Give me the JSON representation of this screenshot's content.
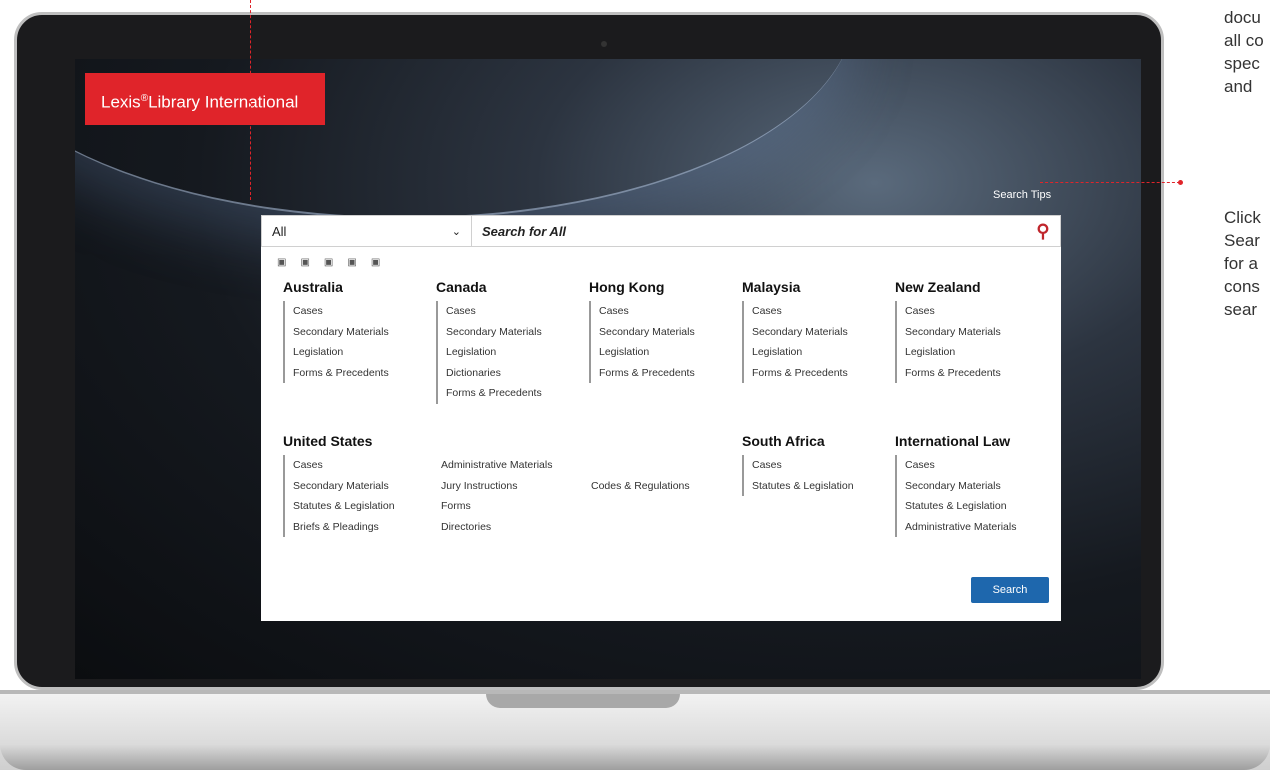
{
  "app": {
    "brand_prefix": "Lexis",
    "brand_reg": "®",
    "brand_suffix": "Library International"
  },
  "search": {
    "scope_label": "All",
    "placeholder": "Search for All",
    "tips_label": "Search Tips"
  },
  "jurisdictions_top": [
    {
      "name": "Australia",
      "items": [
        "Cases",
        "Secondary Materials",
        "Legislation",
        "Forms & Precedents"
      ]
    },
    {
      "name": "Canada",
      "items": [
        "Cases",
        "Secondary Materials",
        "Legislation",
        "Dictionaries",
        "Forms & Precedents"
      ]
    },
    {
      "name": "Hong Kong",
      "items": [
        "Cases",
        "Secondary Materials",
        "Legislation",
        "Forms & Precedents"
      ]
    },
    {
      "name": "Malaysia",
      "items": [
        "Cases",
        "Secondary Materials",
        "Legislation",
        "Forms & Precedents"
      ]
    },
    {
      "name": "New Zealand",
      "items": [
        "Cases",
        "Secondary Materials",
        "Legislation",
        "Forms & Precedents"
      ]
    }
  ],
  "united_states": {
    "name": "United States",
    "col1": [
      "Cases",
      "Secondary Materials",
      "Statutes & Legislation",
      "Briefs & Pleadings"
    ],
    "col2": [
      "Administrative Materials",
      "Jury Instructions",
      "Forms",
      "Directories"
    ],
    "col3": [
      "Codes & Regulations"
    ]
  },
  "south_africa": {
    "name": "South Africa",
    "items": [
      "Cases",
      "Statutes & Legislation"
    ]
  },
  "international_law": {
    "name": "International Law",
    "items": [
      "Cases",
      "Secondary Materials",
      "Statutes & Legislation",
      "Administrative Materials"
    ]
  },
  "search_button_label": "Search",
  "annotations": {
    "block1": [
      "docu",
      "all co",
      "spec",
      "and"
    ],
    "block2": [
      "Click",
      "Sear",
      "for a",
      "cons",
      "sear"
    ]
  },
  "colors": {
    "brand_red": "#e0242a",
    "search_blue": "#1e67ad"
  }
}
